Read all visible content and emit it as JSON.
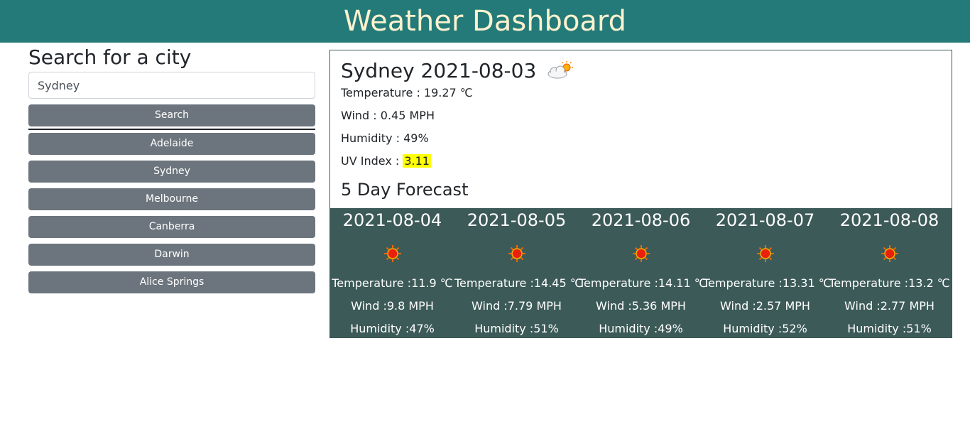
{
  "header": {
    "title": "Weather Dashboard"
  },
  "search": {
    "heading": "Search for a city",
    "input_value": "Sydney",
    "button_label": "Search"
  },
  "history": [
    {
      "label": "Adelaide"
    },
    {
      "label": "Sydney"
    },
    {
      "label": "Melbourne"
    },
    {
      "label": "Canberra"
    },
    {
      "label": "Darwin"
    },
    {
      "label": "Alice Springs"
    }
  ],
  "current": {
    "title": "Sydney 2021-08-03",
    "icon": "cloud-sun-icon",
    "temperature": "Temperature : 19.27 ℃",
    "wind": "Wind : 0.45 MPH",
    "humidity": "Humidity : 49%",
    "uv_label": "UV Index : ",
    "uv_value": "3.11",
    "uv_color": "#ffff00"
  },
  "forecast": {
    "heading": "5 Day Forecast",
    "days": [
      {
        "date": "2021-08-04",
        "icon": "sun-icon",
        "temperature": "Temperature :11.9 ℃",
        "wind": "Wind :9.8 MPH",
        "humidity": "Humidity :47%"
      },
      {
        "date": "2021-08-05",
        "icon": "sun-icon",
        "temperature": "Temperature :14.45 ℃",
        "wind": "Wind :7.79 MPH",
        "humidity": "Humidity :51%"
      },
      {
        "date": "2021-08-06",
        "icon": "sun-icon",
        "temperature": "Temperature :14.11 ℃",
        "wind": "Wind :5.36 MPH",
        "humidity": "Humidity :49%"
      },
      {
        "date": "2021-08-07",
        "icon": "sun-icon",
        "temperature": "Temperature :13.31 ℃",
        "wind": "Wind :2.57 MPH",
        "humidity": "Humidity :52%"
      },
      {
        "date": "2021-08-08",
        "icon": "sun-icon",
        "temperature": "Temperature :13.2 ℃",
        "wind": "Wind :2.77 MPH",
        "humidity": "Humidity :51%"
      }
    ]
  },
  "colors": {
    "header_bg": "#247a78",
    "header_text": "#fbf2cf",
    "button_bg": "#6c757d",
    "forecast_bg": "#3c5a58"
  }
}
